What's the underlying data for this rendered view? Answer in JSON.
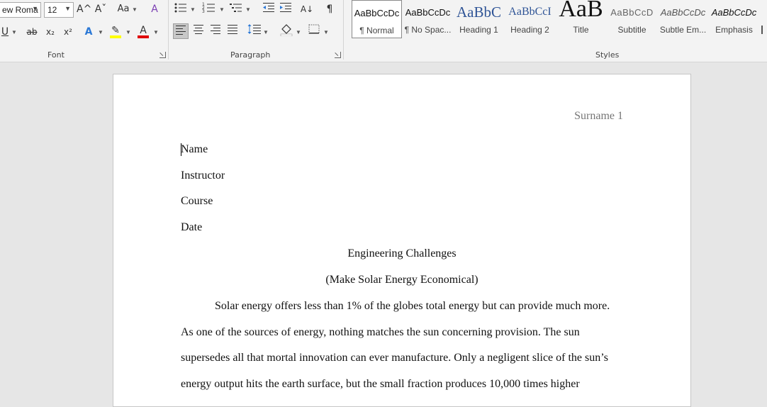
{
  "ribbon": {
    "font_group": {
      "label": "Font",
      "font_name": "ew Roma",
      "font_size": "12",
      "grow_glyph": "A^",
      "shrink_glyph": "Aˇ",
      "case_glyph": "Aa",
      "clear_glyph": "A",
      "underline_glyph": "U",
      "strike_glyph": "ab",
      "sub_glyph": "x₂",
      "sup_glyph": "x²",
      "effects_glyph": "A",
      "highlight_glyph": "✎",
      "color_glyph": "A"
    },
    "paragraph_group": {
      "label": "Paragraph",
      "show_marks_glyph": "¶",
      "sort_glyph": "A↓"
    },
    "styles_group": {
      "label": "Styles",
      "items": [
        {
          "preview": "AaBbCcDc",
          "name": "¶ Normal"
        },
        {
          "preview": "AaBbCcDc",
          "name": "¶ No Spac..."
        },
        {
          "preview": "AaBbC",
          "name": "Heading 1"
        },
        {
          "preview": "AaBbCcI",
          "name": "Heading 2"
        },
        {
          "preview": "AaB",
          "name": "Title"
        },
        {
          "preview": "AaBbCcD",
          "name": "Subtitle"
        },
        {
          "preview": "AaBbCcDc",
          "name": "Subtle Em..."
        },
        {
          "preview": "AaBbCcDc",
          "name": "Emphasis"
        }
      ]
    },
    "colors": {
      "highlight": "#ffff00",
      "font_color": "#e00000",
      "heading": "#2f5496"
    }
  },
  "document": {
    "header": "Surname 1",
    "lines": [
      "Name",
      "Instructor",
      "Course",
      "Date",
      "Engineering Challenges",
      "(Make Solar Energy Economical)",
      "Solar energy offers less than 1% of the globes total energy but can provide much more.",
      "As one of the sources of energy, nothing matches the sun concerning provision. The sun",
      "supersedes all that mortal innovation can ever manufacture. Only a negligent slice of the sun’s",
      "energy output hits the earth surface, but the small fraction produces 10,000 times higher"
    ]
  }
}
